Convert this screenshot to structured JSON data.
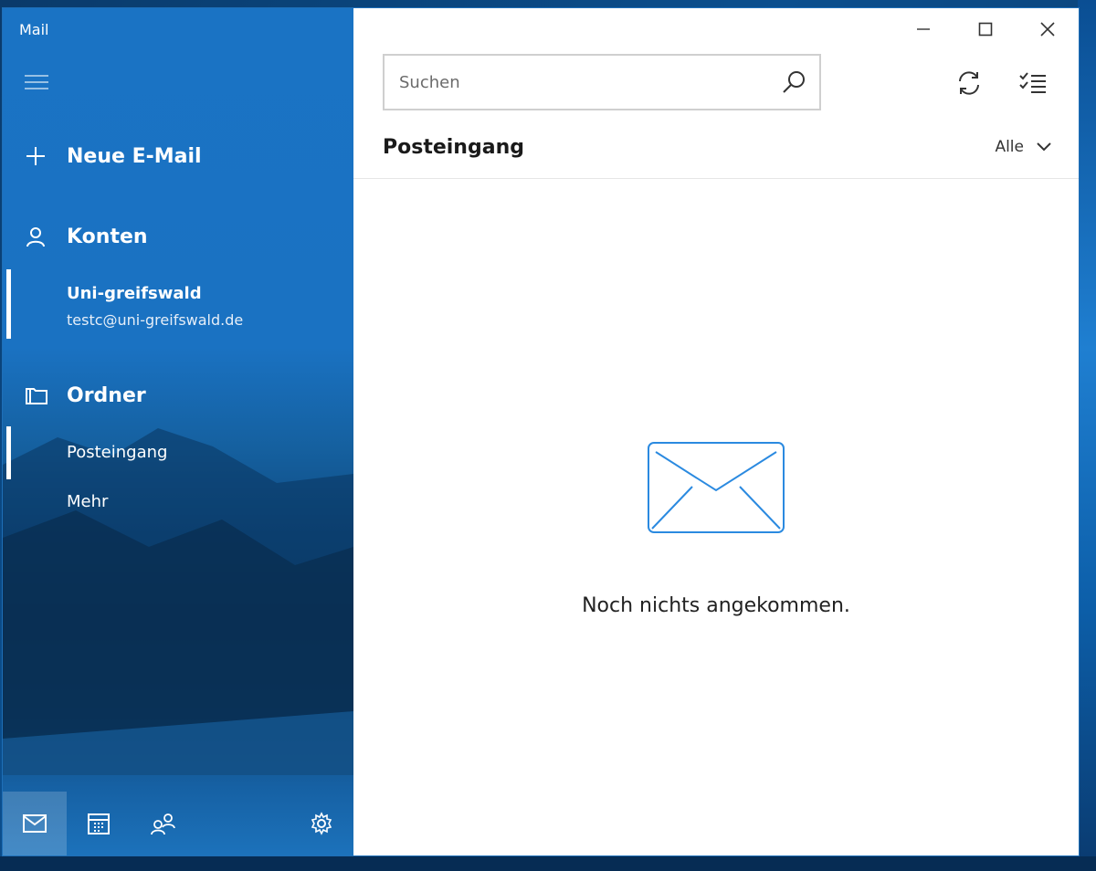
{
  "app": {
    "title": "Mail"
  },
  "sidebar": {
    "new_mail_label": "Neue E-Mail",
    "accounts_label": "Konten",
    "account": {
      "name": "Uni-greifswald",
      "email": "testc@uni-greifswald.de"
    },
    "folders_label": "Ordner",
    "folders": [
      {
        "label": "Posteingang"
      }
    ],
    "more_label": "Mehr"
  },
  "main": {
    "search": {
      "placeholder": "Suchen",
      "value": ""
    },
    "folder_title": "Posteingang",
    "filter": {
      "selected": "Alle"
    },
    "empty_message": "Noch nichts angekommen."
  },
  "colors": {
    "accent": "#1a73c4",
    "envelope_stroke": "#2b8ae0"
  }
}
